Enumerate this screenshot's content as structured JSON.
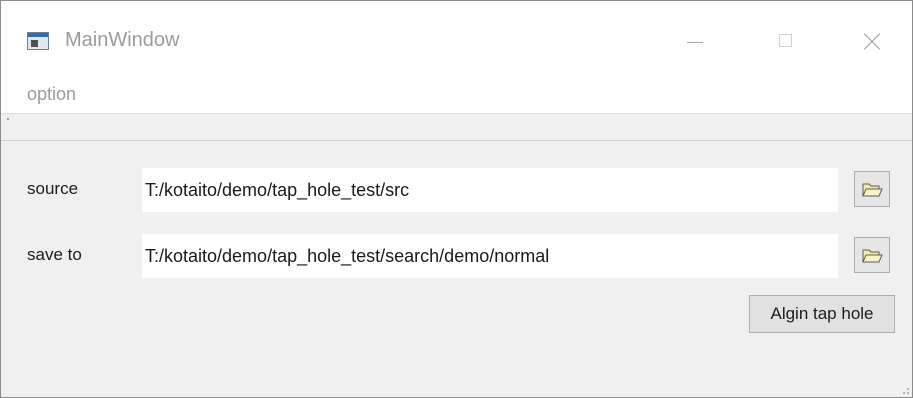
{
  "window": {
    "title": "MainWindow",
    "icon": "app-window-icon",
    "controls": [
      "minimize-icon",
      "maximize-icon",
      "close-icon"
    ]
  },
  "menubar": {
    "items": [
      {
        "label": "option"
      }
    ]
  },
  "form": {
    "source": {
      "label": "source",
      "value": "T:/kotaito/demo/tap_hole_test/src",
      "browse_icon": "folder-open-icon"
    },
    "save_to": {
      "label": "save to",
      "value": "T:/kotaito/demo/tap_hole_test/search/demo/normal",
      "browse_icon": "folder-open-icon"
    }
  },
  "actions": {
    "align_label": "Algin tap hole"
  },
  "colors": {
    "window_bg": "#f0f0f0",
    "titlebar_bg": "#ffffff",
    "folder_fill": "#f4eca4",
    "folder_stroke": "#5c5c5c"
  }
}
